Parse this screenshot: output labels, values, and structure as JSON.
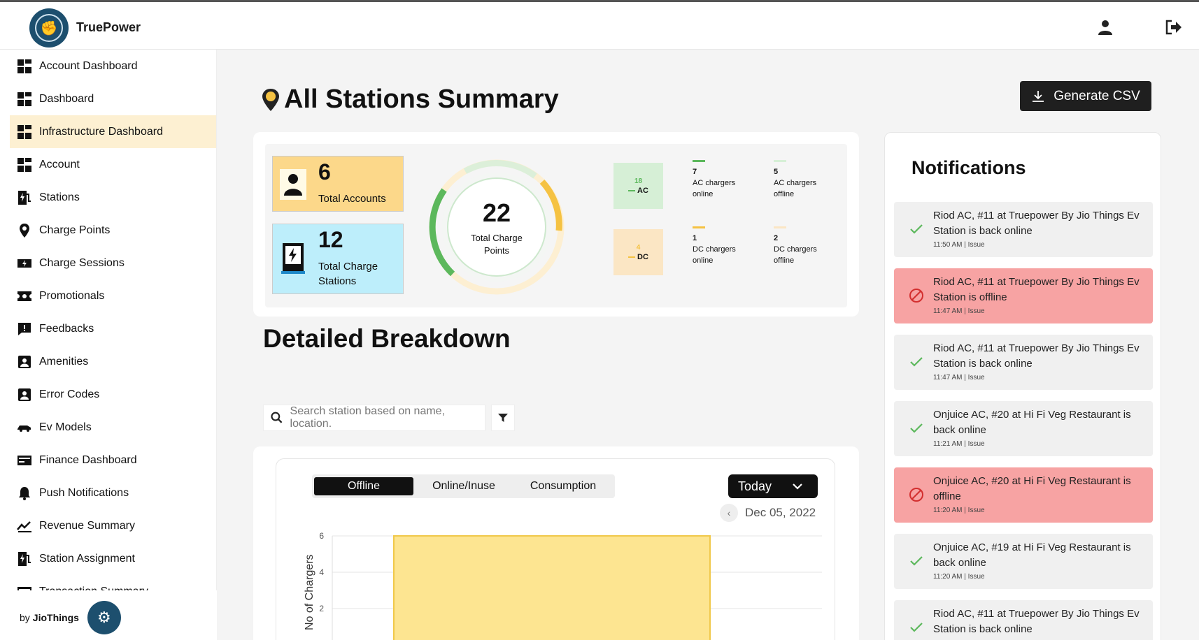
{
  "app": {
    "brand": "TruePower",
    "footer_by": "by",
    "footer_company": "JioThings"
  },
  "sidebar": {
    "items": [
      {
        "label": "Account Dashboard",
        "icon": "dashboard-icon"
      },
      {
        "label": "Dashboard",
        "icon": "dashboard-icon"
      },
      {
        "label": "Infrastructure Dashboard",
        "icon": "dashboard-icon",
        "active": true
      },
      {
        "label": "Account",
        "icon": "dashboard-icon"
      },
      {
        "label": "Stations",
        "icon": "station-icon"
      },
      {
        "label": "Charge Points",
        "icon": "pin-icon"
      },
      {
        "label": "Charge Sessions",
        "icon": "session-icon"
      },
      {
        "label": "Promotionals",
        "icon": "ticket-icon"
      },
      {
        "label": "Feedbacks",
        "icon": "feedback-icon"
      },
      {
        "label": "Amenities",
        "icon": "amenities-icon"
      },
      {
        "label": "Error Codes",
        "icon": "error-icon"
      },
      {
        "label": "Ev Models",
        "icon": "car-icon"
      },
      {
        "label": "Finance Dashboard",
        "icon": "finance-icon"
      },
      {
        "label": "Push Notifications",
        "icon": "bell-icon"
      },
      {
        "label": "Revenue Summary",
        "icon": "revenue-icon"
      },
      {
        "label": "Station Assignment",
        "icon": "station-icon"
      },
      {
        "label": "Transaction Summary",
        "icon": "finance-icon"
      }
    ]
  },
  "main": {
    "title": "All Stations Summary",
    "csv_button": "Generate CSV",
    "summary": {
      "accounts": {
        "value": "6",
        "label": "Total Accounts"
      },
      "stations": {
        "value": "12",
        "label": "Total Charge Stations"
      },
      "charge_points": {
        "value": "22",
        "label": "Total Charge Points"
      },
      "ac": {
        "count": "18",
        "label": "AC",
        "online_count": "7",
        "online_label": "AC chargers online",
        "offline_count": "5",
        "offline_label": "AC chargers offline"
      },
      "dc": {
        "count": "4",
        "label": "DC",
        "online_count": "1",
        "online_label": "DC chargers online",
        "offline_count": "2",
        "offline_label": "DC chargers offline"
      }
    },
    "breakdown": {
      "title": "Detailed Breakdown",
      "search_placeholder": "Search station based on name, location.",
      "tabs": [
        "Offline",
        "Online/Inuse",
        "Consumption"
      ],
      "period": "Today",
      "date": "Dec 05, 2022"
    }
  },
  "chart_data": {
    "type": "bar",
    "ylabel": "No of Chargers",
    "ylim": [
      0,
      6
    ],
    "yticks": [
      "6",
      "4",
      "2"
    ],
    "values": [
      6
    ]
  },
  "notifications": {
    "title": "Notifications",
    "items": [
      {
        "text": "Riod AC, #11 at Truepower By Jio Things Ev Station is back online",
        "meta": "11:50 AM | Issue",
        "status": "online"
      },
      {
        "text": "Riod AC, #11 at Truepower By Jio Things Ev Station is offline",
        "meta": "11:47 AM | Issue",
        "status": "offline"
      },
      {
        "text": "Riod AC, #11 at Truepower By Jio Things Ev Station is back online",
        "meta": "11:47 AM | Issue",
        "status": "online"
      },
      {
        "text": "Onjuice AC, #20 at Hi Fi Veg Restaurant is back online",
        "meta": "11:21 AM | Issue",
        "status": "online"
      },
      {
        "text": "Onjuice AC, #20 at Hi Fi Veg Restaurant is offline",
        "meta": "11:20 AM | Issue",
        "status": "offline"
      },
      {
        "text": "Onjuice AC, #19 at Hi Fi Veg Restaurant is back online",
        "meta": "11:20 AM | Issue",
        "status": "online"
      },
      {
        "text": "Riod AC, #11 at Truepower By Jio Things Ev Station is back online",
        "meta": "",
        "status": "online"
      }
    ]
  },
  "colors": {
    "accent": "#fdf0d2",
    "online": "#5cb85c",
    "offline": "#f7a3a3",
    "brand": "#1d4f6e",
    "bar": "#fde591"
  }
}
